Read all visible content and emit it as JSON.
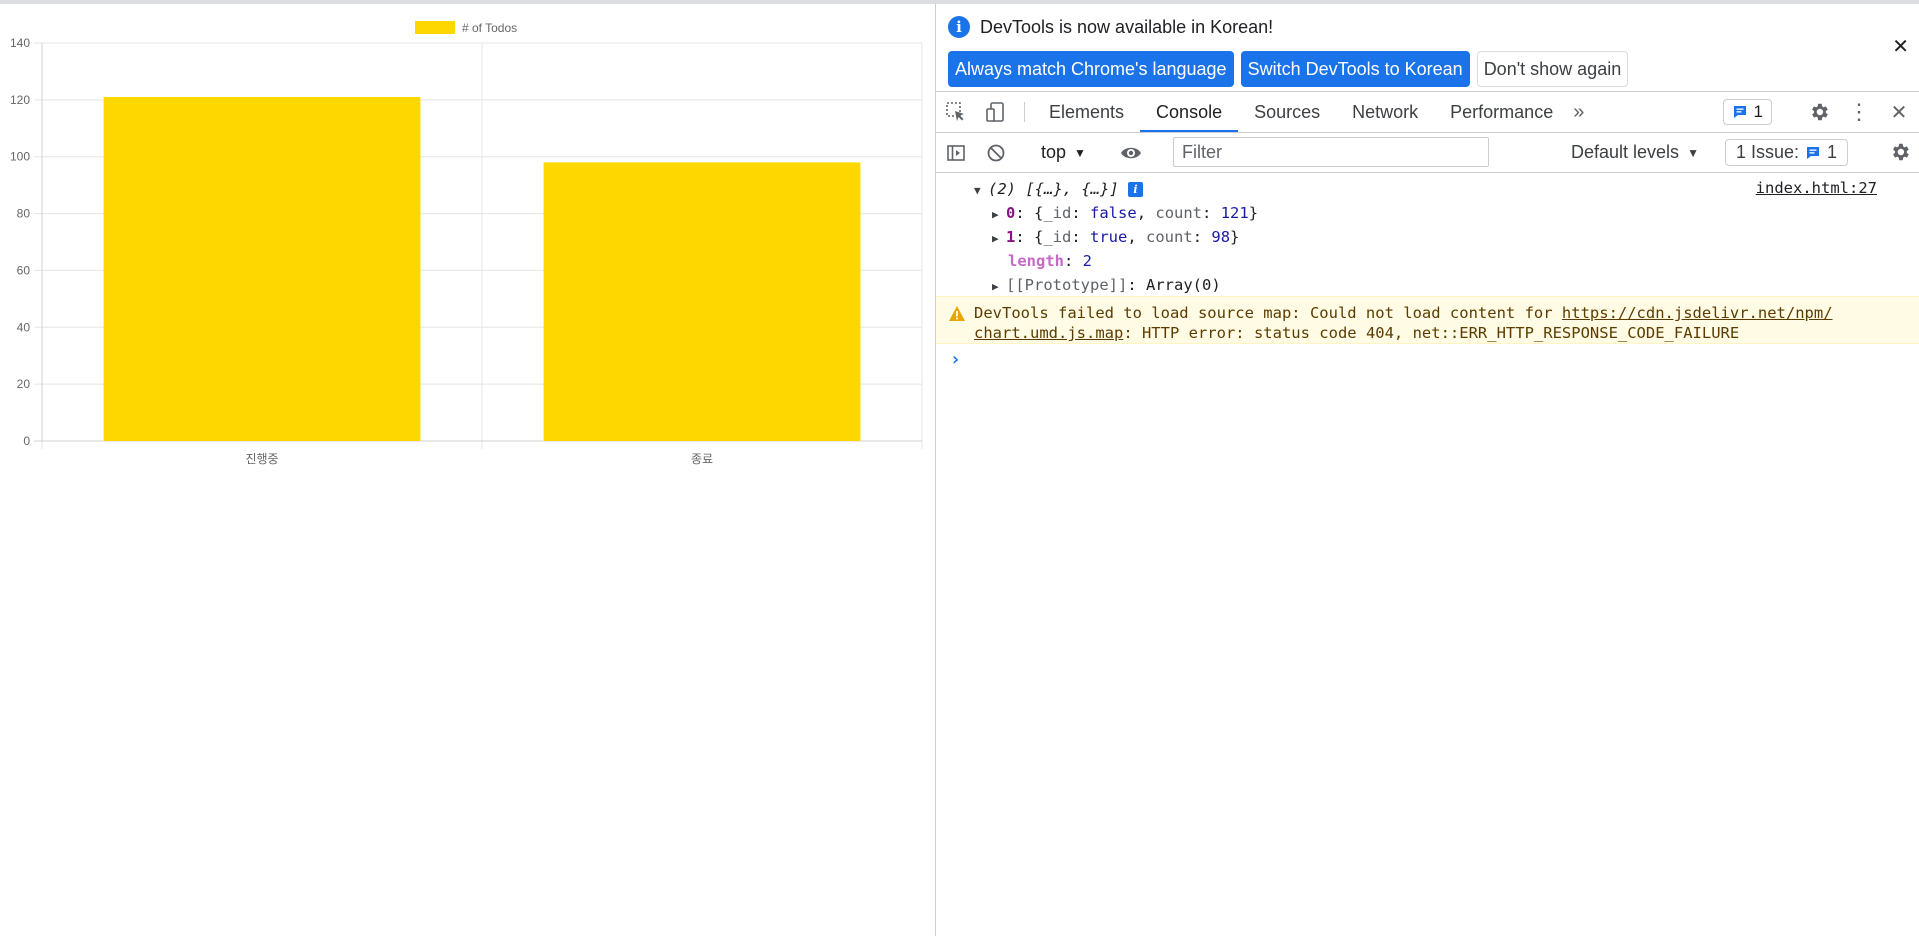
{
  "chart_data": {
    "type": "bar",
    "categories": [
      "진행중",
      "종료"
    ],
    "series": [
      {
        "name": "# of Todos",
        "values": [
          121,
          98
        ],
        "color": "#ffd700"
      }
    ],
    "ylim": [
      0,
      140
    ],
    "yticks": [
      0,
      20,
      40,
      60,
      80,
      100,
      120,
      140
    ],
    "grid": true,
    "legend_position": "top"
  },
  "devtools": {
    "infobar": {
      "message": "DevTools is now available in Korean!",
      "btn_match": "Always match Chrome's language",
      "btn_switch": "Switch DevTools to Korean",
      "btn_dismiss": "Don't show again"
    },
    "tabs": [
      "Elements",
      "Console",
      "Sources",
      "Network",
      "Performance"
    ],
    "active_tab": "Console",
    "messages_badge_count": "1",
    "toolbar": {
      "context": "top",
      "filter_placeholder": "Filter",
      "levels": "Default levels",
      "issues_label": "1 Issue:",
      "issues_count": "1"
    },
    "console": {
      "source_link": "index.html:27",
      "array_summary": "(2) [{…}, {…}]",
      "item0_key": "0",
      "item0_id": "false",
      "item0_count": "121",
      "item1_key": "1",
      "item1_id": "true",
      "item1_count": "98",
      "length_key": "length",
      "length_value": "2",
      "prototype_key": "[[Prototype]]",
      "prototype_value": "Array(0)",
      "warning_prefix": "DevTools failed to load source map: Could not load content for ",
      "warning_url_1": "https://cdn.jsdelivr.net/npm/",
      "warning_url_2": "chart.umd.js.map",
      "warning_suffix": ": HTTP error: status code 404, net::ERR_HTTP_RESPONSE_CODE_FAILURE"
    }
  }
}
